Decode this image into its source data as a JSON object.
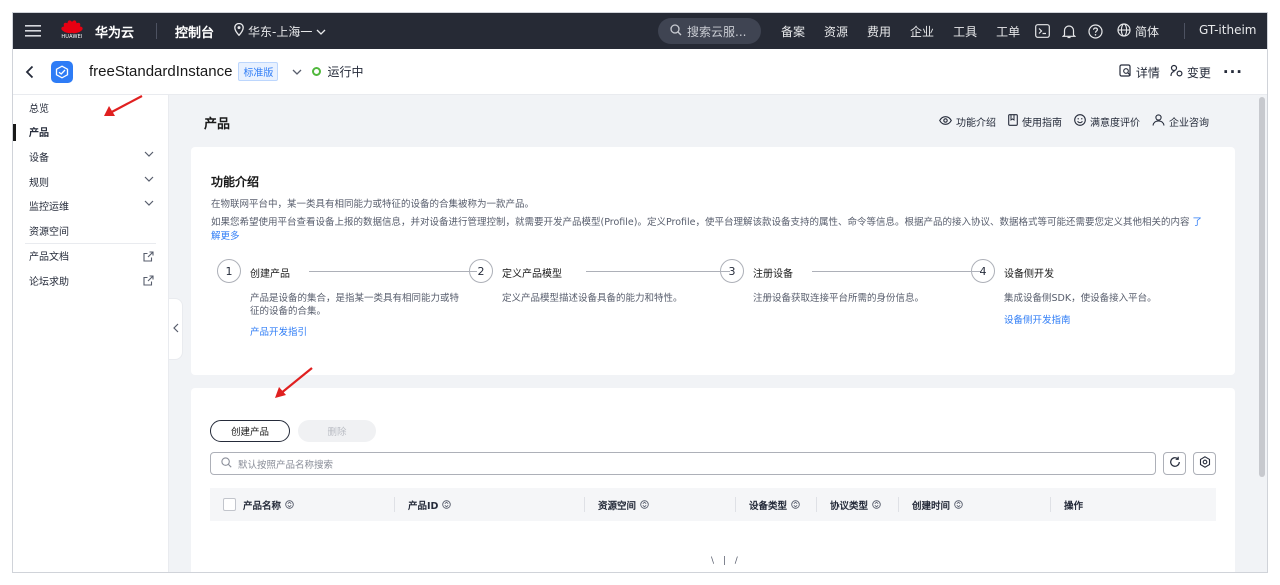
{
  "topbar": {
    "logo_text": "HUAWEI",
    "brand": "华为云",
    "console": "控制台",
    "region": "华东-上海一",
    "search_placeholder": "搜索云服...",
    "nav": [
      "备案",
      "资源",
      "费用",
      "企业",
      "工具",
      "工单"
    ],
    "language": "简体",
    "user": "GT-itheim"
  },
  "instance": {
    "name": "freeStandardInstance",
    "edition": "标准版",
    "status": "运行中",
    "details": "详情",
    "change": "变更",
    "more": "···"
  },
  "sidebar": {
    "items": [
      {
        "label": "总览",
        "expandable": false,
        "external": false,
        "active": false
      },
      {
        "label": "产品",
        "expandable": false,
        "external": false,
        "active": true
      },
      {
        "label": "设备",
        "expandable": true,
        "external": false,
        "active": false
      },
      {
        "label": "规则",
        "expandable": true,
        "external": false,
        "active": false
      },
      {
        "label": "监控运维",
        "expandable": true,
        "external": false,
        "active": false
      },
      {
        "label": "资源空间",
        "expandable": false,
        "external": false,
        "active": false
      },
      {
        "label": "产品文档",
        "expandable": false,
        "external": true,
        "active": false
      },
      {
        "label": "论坛求助",
        "expandable": false,
        "external": true,
        "active": false
      }
    ]
  },
  "page": {
    "title": "产品",
    "links": [
      "功能介绍",
      "使用指南",
      "满意度评价",
      "企业咨询"
    ]
  },
  "intro": {
    "title": "功能介绍",
    "p1": "在物联网平台中，某一类具有相同能力或特征的设备的合集被称为一款产品。",
    "p2": "如果您希望使用平台查看设备上报的数据信息，并对设备进行管理控制，就需要开发产品模型(Profile)。定义Profile，使平台理解该款设备支持的属性、命令等信息。根据产品的接入协议、数据格式等可能还需要您定义其他相关的内容",
    "more_link": "了解更多",
    "steps": [
      {
        "num": "1",
        "title": "创建产品",
        "desc": "产品是设备的集合，是指某一类具有相同能力或特征的设备的合集。",
        "link": "产品开发指引"
      },
      {
        "num": "2",
        "title": "定义产品模型",
        "desc": "定义产品模型描述设备具备的能力和特性。",
        "link": ""
      },
      {
        "num": "3",
        "title": "注册设备",
        "desc": "注册设备获取连接平台所需的身份信息。",
        "link": ""
      },
      {
        "num": "4",
        "title": "设备侧开发",
        "desc": "集成设备侧SDK，使设备接入平台。",
        "link": "设备侧开发指南"
      }
    ]
  },
  "list": {
    "create_button": "创建产品",
    "delete_button": "删除",
    "search_placeholder": "默认按照产品名称搜索",
    "columns": [
      "产品名称",
      "产品ID",
      "资源空间",
      "设备类型",
      "协议类型",
      "创建时间",
      "操作"
    ],
    "loading": "\\ | /"
  },
  "colors": {
    "topbar_bg": "#262a35",
    "accent": "#2e7cf6",
    "status_ok": "#50b83c",
    "annotation_arrow": "#e02020",
    "huawei_red": "#e60012"
  },
  "icons": [
    "menu-icon",
    "huawei-logo",
    "location-icon",
    "chevron-down-icon",
    "search-icon",
    "terminal-icon",
    "bell-icon",
    "help-icon",
    "globe-icon",
    "back-icon",
    "instance-icon",
    "details-icon",
    "change-icon",
    "eye-icon",
    "book-icon",
    "smile-icon",
    "consult-icon",
    "external-link-icon",
    "refresh-icon",
    "settings-icon",
    "sort-icon"
  ]
}
